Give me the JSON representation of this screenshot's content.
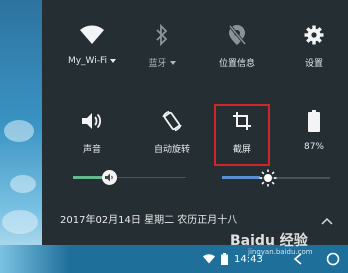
{
  "quick_settings": {
    "row1": [
      {
        "label": "My_Wi-Fi",
        "icon": "wifi-icon",
        "active": true,
        "has_menu": true
      },
      {
        "label": "蓝牙",
        "icon": "bluetooth-icon",
        "active": false,
        "has_menu": true
      },
      {
        "label": "位置信息",
        "icon": "location-icon",
        "active": false,
        "has_menu": false
      },
      {
        "label": "设置",
        "icon": "gear-icon",
        "active": true,
        "has_menu": false
      }
    ],
    "row2": [
      {
        "label": "声音",
        "icon": "speaker-icon",
        "active": true
      },
      {
        "label": "自动旋转",
        "icon": "rotate-icon",
        "active": true
      },
      {
        "label": "截屏",
        "icon": "crop-icon",
        "active": true,
        "highlighted": true
      },
      {
        "label": "87%",
        "icon": "battery-icon",
        "active": true
      }
    ]
  },
  "sliders": {
    "volume_level": 0.3,
    "brightness_level": 0.35
  },
  "date_line": "2017年02月14日   星期二   农历正月十八",
  "nav": {
    "time": "14:43"
  },
  "watermark": {
    "brand": "Baidu 经验",
    "url": "jingyan.baidu.com"
  },
  "colors": {
    "panel_bg": "#252e33",
    "highlight_border": "#d0262a",
    "volume_accent": "#62b98c",
    "brightness_accent": "#5b8fd6"
  }
}
